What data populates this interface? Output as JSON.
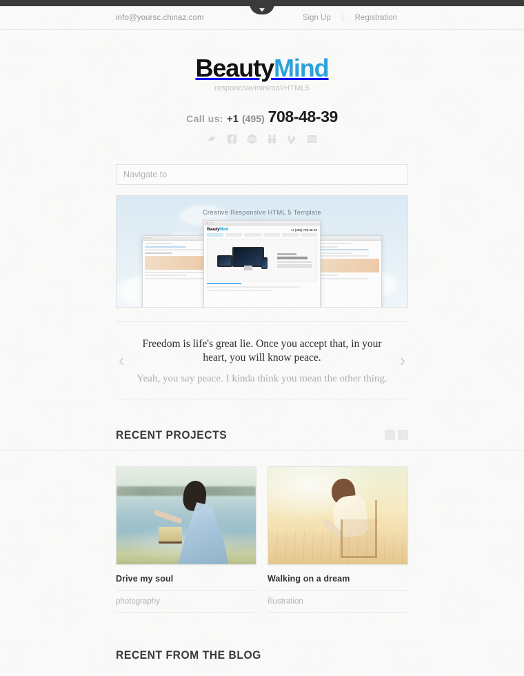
{
  "topbar": {
    "pull_tab_icon": "chevron-down-icon"
  },
  "utility": {
    "email": "info@yoursc.chinaz.com",
    "sign_up": "Sign Up",
    "separator": "|",
    "registration": "Registration"
  },
  "brand": {
    "name_part1": "Beauty",
    "name_part2": "Mind",
    "accent_color": "#2aa3dd",
    "tagline": "responcive/minimal/HTML5"
  },
  "contact": {
    "call_label": "Call us:",
    "country_code": "+1",
    "area_code": "(495)",
    "number": "708-48-39",
    "socials": [
      {
        "name": "twitter-icon",
        "label": "Twitter"
      },
      {
        "name": "facebook-icon",
        "label": "Facebook"
      },
      {
        "name": "stumbleupon-icon",
        "label": "StumbleUpon"
      },
      {
        "name": "friendfeed-icon",
        "label": "FriendFeed"
      },
      {
        "name": "vimeo-icon",
        "label": "Vimeo"
      },
      {
        "name": "youtube-icon",
        "label": "YouTube"
      }
    ]
  },
  "navigate": {
    "placeholder": "Navigate to"
  },
  "hero": {
    "caption": "Creative Responsive HTML 5 Template",
    "mock_logo_part1": "Beauty",
    "mock_logo_part2": "Mind",
    "mock_phone": "+1 (495) 708-48-39"
  },
  "quote": {
    "main": "Freedom is life's great lie. Once you accept that, in your heart, you will know peace.",
    "sub": "Yeah, you say peace. I kinda think you mean the other thing.",
    "prev_icon": "‹",
    "next_icon": "›"
  },
  "projects_section": {
    "title": "RECENT PROJECTS",
    "prev_icon": "‹",
    "next_icon": "›",
    "items": [
      {
        "title": "Drive my soul",
        "category": "photography"
      },
      {
        "title": "Walking on a dream",
        "category": "illustration"
      }
    ]
  },
  "blog_section": {
    "title": "RECENT FROM THE BLOG"
  }
}
